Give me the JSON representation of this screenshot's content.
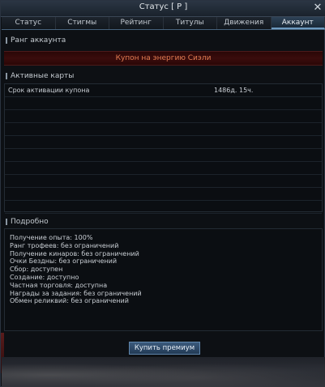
{
  "window": {
    "title": "Статус [ P ]",
    "close_icon": "close-icon"
  },
  "tabs": [
    {
      "label": "Статус",
      "active": false
    },
    {
      "label": "Стигмы",
      "active": false
    },
    {
      "label": "Рейтинг",
      "active": false
    },
    {
      "label": "Титулы",
      "active": false
    },
    {
      "label": "Движения",
      "active": false
    },
    {
      "label": "Аккаунт",
      "active": true
    }
  ],
  "rank": {
    "heading": "Ранг аккаунта",
    "value": "Купон на энергию Сиэли",
    "value_color": "#e07c52"
  },
  "cards": {
    "heading": "Активные карты",
    "rows": [
      {
        "name": "Срок активации купона",
        "value": "1486д. 15ч."
      }
    ],
    "empty_rows": 9
  },
  "details": {
    "heading": "Подробно",
    "lines": [
      "Получение опыта: 100%",
      "Ранг трофеев: без ограничений",
      "Получение кинаров: без ограничений",
      "Очки Бездны: без ограничений",
      "Сбор: доступен",
      "Создание: доступно",
      "Частная торговля: доступна",
      "Награды за задания: без ограничений",
      "Обмен реликвий: без ограничений"
    ]
  },
  "footer": {
    "buy_button": "Купить премиум"
  }
}
